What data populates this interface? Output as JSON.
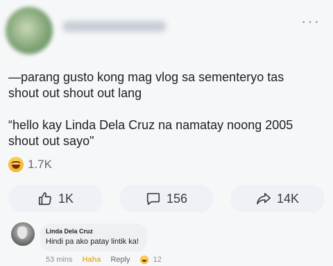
{
  "post": {
    "more_label": "···",
    "text": "—parang gusto kong mag vlog sa sementeryo tas\nshout out shout out lang\n\n“hello kay Linda Dela Cruz na namatay noong 2005\nshout out sayo\"",
    "reaction_icon": "haha-emoji-icon",
    "reaction_count": "1.7K"
  },
  "actions": {
    "like_count": "1K",
    "comment_count": "156",
    "share_count": "14K"
  },
  "comment": {
    "author": "Linda Dela Cruz",
    "text": "Hindi pa ako patay lintik ka!",
    "time": "53 mins",
    "haha_label": "Haha",
    "reply_label": "Reply",
    "reaction_count": "12"
  },
  "colors": {
    "background": "#f6f7f9",
    "button_bg": "#eef1f6",
    "haha_yellow": "#e8b431"
  }
}
